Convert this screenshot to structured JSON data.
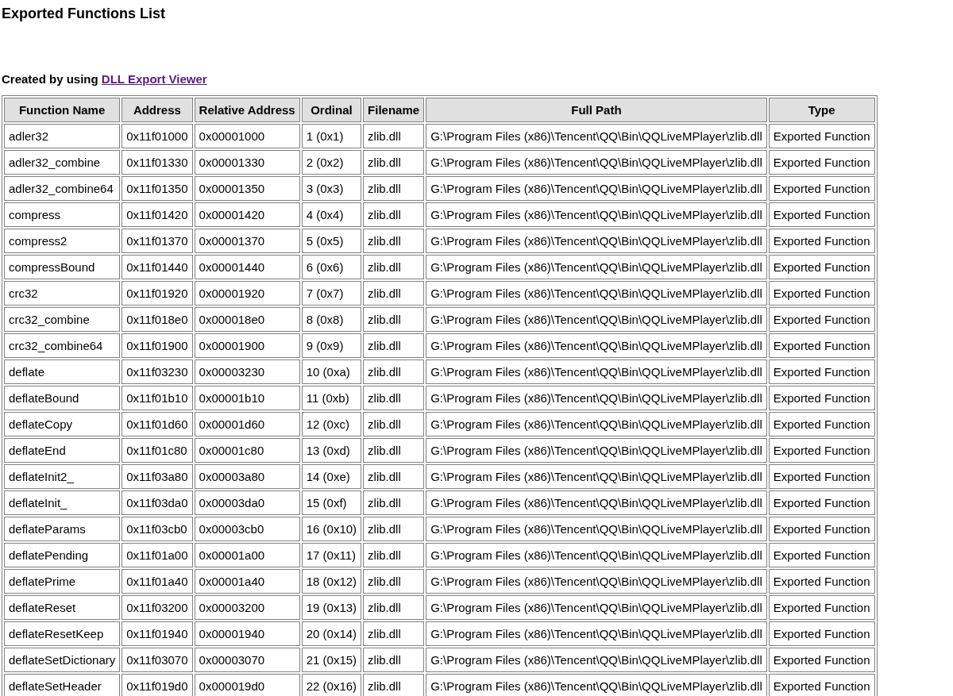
{
  "page": {
    "title": "Exported Functions List",
    "credit_text": "Created by using ",
    "credit_link": "DLL Export Viewer"
  },
  "table": {
    "columns": [
      "Function Name",
      "Address",
      "Relative Address",
      "Ordinal",
      "Filename",
      "Full Path",
      "Type"
    ],
    "rows": [
      [
        "adler32",
        "0x11f01000",
        "0x00001000",
        "1 (0x1)",
        "zlib.dll",
        "G:\\Program Files (x86)\\Tencent\\QQ\\Bin\\QQLiveMPlayer\\zlib.dll",
        "Exported Function"
      ],
      [
        "adler32_combine",
        "0x11f01330",
        "0x00001330",
        "2 (0x2)",
        "zlib.dll",
        "G:\\Program Files (x86)\\Tencent\\QQ\\Bin\\QQLiveMPlayer\\zlib.dll",
        "Exported Function"
      ],
      [
        "adler32_combine64",
        "0x11f01350",
        "0x00001350",
        "3 (0x3)",
        "zlib.dll",
        "G:\\Program Files (x86)\\Tencent\\QQ\\Bin\\QQLiveMPlayer\\zlib.dll",
        "Exported Function"
      ],
      [
        "compress",
        "0x11f01420",
        "0x00001420",
        "4 (0x4)",
        "zlib.dll",
        "G:\\Program Files (x86)\\Tencent\\QQ\\Bin\\QQLiveMPlayer\\zlib.dll",
        "Exported Function"
      ],
      [
        "compress2",
        "0x11f01370",
        "0x00001370",
        "5 (0x5)",
        "zlib.dll",
        "G:\\Program Files (x86)\\Tencent\\QQ\\Bin\\QQLiveMPlayer\\zlib.dll",
        "Exported Function"
      ],
      [
        "compressBound",
        "0x11f01440",
        "0x00001440",
        "6 (0x6)",
        "zlib.dll",
        "G:\\Program Files (x86)\\Tencent\\QQ\\Bin\\QQLiveMPlayer\\zlib.dll",
        "Exported Function"
      ],
      [
        "crc32",
        "0x11f01920",
        "0x00001920",
        "7 (0x7)",
        "zlib.dll",
        "G:\\Program Files (x86)\\Tencent\\QQ\\Bin\\QQLiveMPlayer\\zlib.dll",
        "Exported Function"
      ],
      [
        "crc32_combine",
        "0x11f018e0",
        "0x000018e0",
        "8 (0x8)",
        "zlib.dll",
        "G:\\Program Files (x86)\\Tencent\\QQ\\Bin\\QQLiveMPlayer\\zlib.dll",
        "Exported Function"
      ],
      [
        "crc32_combine64",
        "0x11f01900",
        "0x00001900",
        "9 (0x9)",
        "zlib.dll",
        "G:\\Program Files (x86)\\Tencent\\QQ\\Bin\\QQLiveMPlayer\\zlib.dll",
        "Exported Function"
      ],
      [
        "deflate",
        "0x11f03230",
        "0x00003230",
        "10 (0xa)",
        "zlib.dll",
        "G:\\Program Files (x86)\\Tencent\\QQ\\Bin\\QQLiveMPlayer\\zlib.dll",
        "Exported Function"
      ],
      [
        "deflateBound",
        "0x11f01b10",
        "0x00001b10",
        "11 (0xb)",
        "zlib.dll",
        "G:\\Program Files (x86)\\Tencent\\QQ\\Bin\\QQLiveMPlayer\\zlib.dll",
        "Exported Function"
      ],
      [
        "deflateCopy",
        "0x11f01d60",
        "0x00001d60",
        "12 (0xc)",
        "zlib.dll",
        "G:\\Program Files (x86)\\Tencent\\QQ\\Bin\\QQLiveMPlayer\\zlib.dll",
        "Exported Function"
      ],
      [
        "deflateEnd",
        "0x11f01c80",
        "0x00001c80",
        "13 (0xd)",
        "zlib.dll",
        "G:\\Program Files (x86)\\Tencent\\QQ\\Bin\\QQLiveMPlayer\\zlib.dll",
        "Exported Function"
      ],
      [
        "deflateInit2_",
        "0x11f03a80",
        "0x00003a80",
        "14 (0xe)",
        "zlib.dll",
        "G:\\Program Files (x86)\\Tencent\\QQ\\Bin\\QQLiveMPlayer\\zlib.dll",
        "Exported Function"
      ],
      [
        "deflateInit_",
        "0x11f03da0",
        "0x00003da0",
        "15 (0xf)",
        "zlib.dll",
        "G:\\Program Files (x86)\\Tencent\\QQ\\Bin\\QQLiveMPlayer\\zlib.dll",
        "Exported Function"
      ],
      [
        "deflateParams",
        "0x11f03cb0",
        "0x00003cb0",
        "16 (0x10)",
        "zlib.dll",
        "G:\\Program Files (x86)\\Tencent\\QQ\\Bin\\QQLiveMPlayer\\zlib.dll",
        "Exported Function"
      ],
      [
        "deflatePending",
        "0x11f01a00",
        "0x00001a00",
        "17 (0x11)",
        "zlib.dll",
        "G:\\Program Files (x86)\\Tencent\\QQ\\Bin\\QQLiveMPlayer\\zlib.dll",
        "Exported Function"
      ],
      [
        "deflatePrime",
        "0x11f01a40",
        "0x00001a40",
        "18 (0x12)",
        "zlib.dll",
        "G:\\Program Files (x86)\\Tencent\\QQ\\Bin\\QQLiveMPlayer\\zlib.dll",
        "Exported Function"
      ],
      [
        "deflateReset",
        "0x11f03200",
        "0x00003200",
        "19 (0x13)",
        "zlib.dll",
        "G:\\Program Files (x86)\\Tencent\\QQ\\Bin\\QQLiveMPlayer\\zlib.dll",
        "Exported Function"
      ],
      [
        "deflateResetKeep",
        "0x11f01940",
        "0x00001940",
        "20 (0x14)",
        "zlib.dll",
        "G:\\Program Files (x86)\\Tencent\\QQ\\Bin\\QQLiveMPlayer\\zlib.dll",
        "Exported Function"
      ],
      [
        "deflateSetDictionary",
        "0x11f03070",
        "0x00003070",
        "21 (0x15)",
        "zlib.dll",
        "G:\\Program Files (x86)\\Tencent\\QQ\\Bin\\QQLiveMPlayer\\zlib.dll",
        "Exported Function"
      ],
      [
        "deflateSetHeader",
        "0x11f019d0",
        "0x000019d0",
        "22 (0x16)",
        "zlib.dll",
        "G:\\Program Files (x86)\\Tencent\\QQ\\Bin\\QQLiveMPlayer\\zlib.dll",
        "Exported Function"
      ]
    ]
  }
}
